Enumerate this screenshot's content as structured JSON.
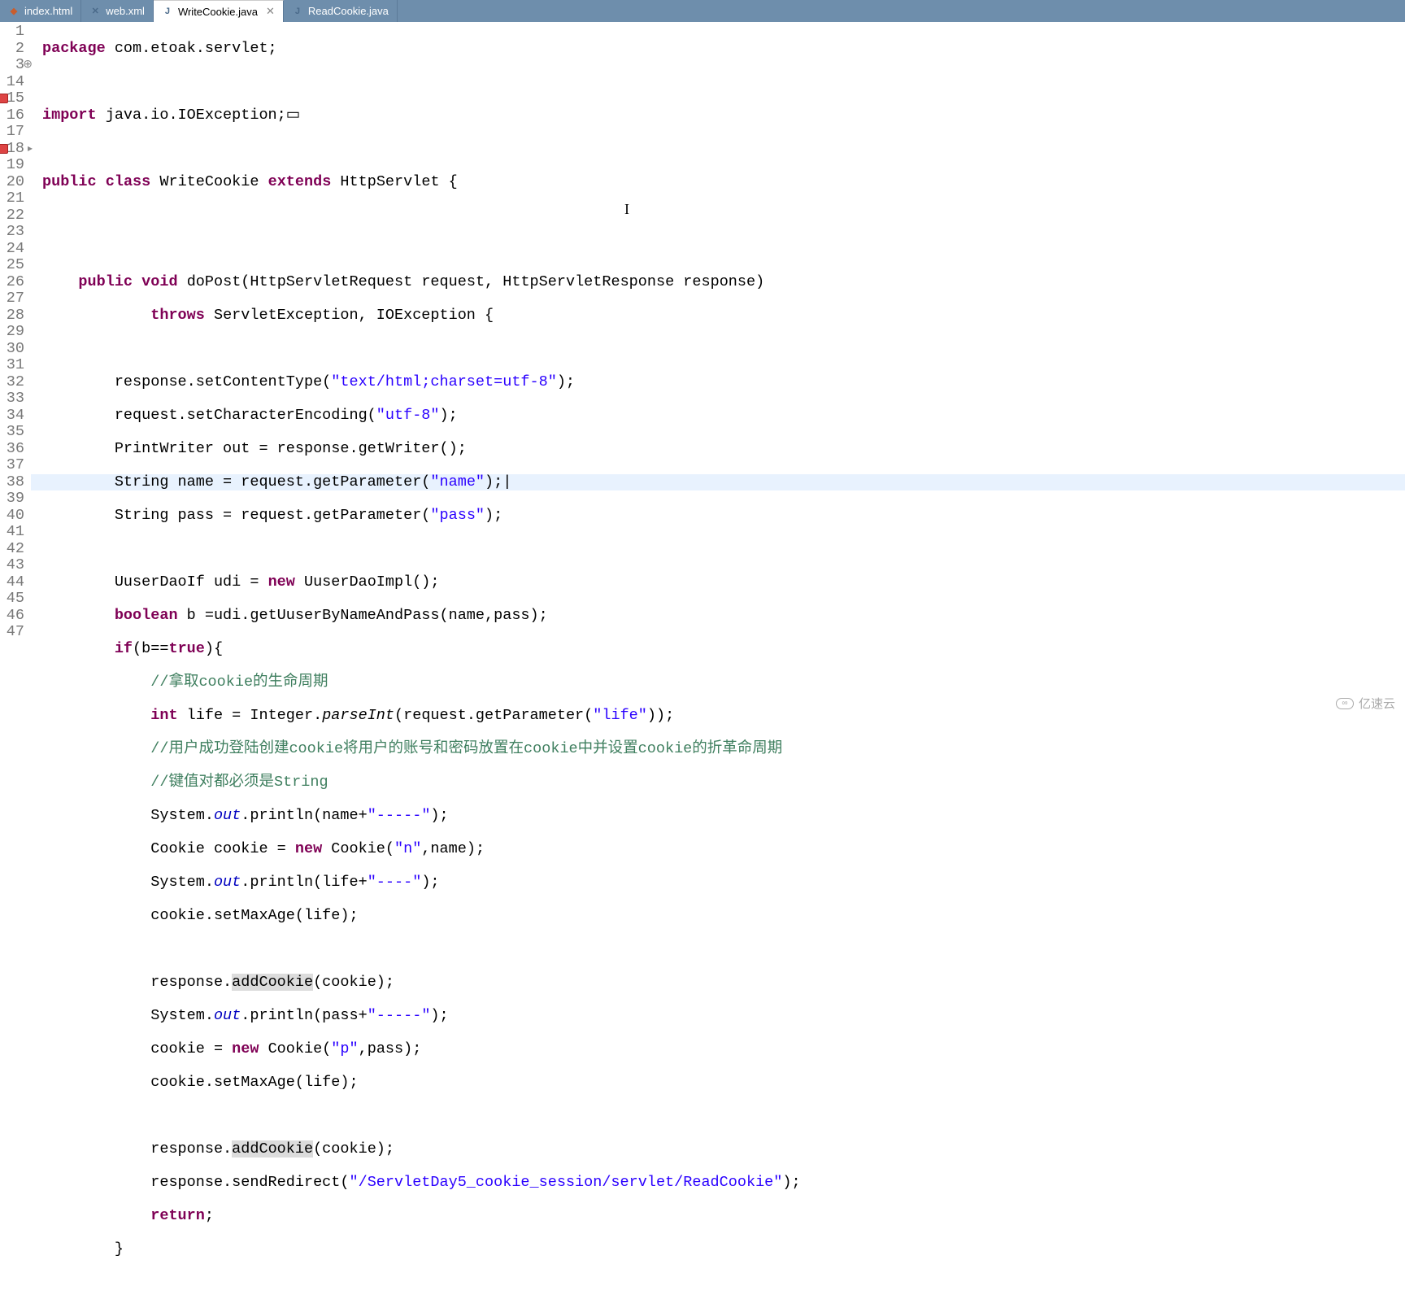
{
  "tabs": [
    {
      "label": "index.html",
      "icon": "html-icon",
      "glyph": "◆"
    },
    {
      "label": "web.xml",
      "icon": "xml-icon",
      "glyph": "✕"
    },
    {
      "label": "WriteCookie.java",
      "icon": "java-icon",
      "glyph": "J",
      "active": true,
      "closable": true
    },
    {
      "label": "ReadCookie.java",
      "icon": "java-icon",
      "glyph": "J"
    }
  ],
  "gutter": [
    "1",
    "2",
    "3",
    "14",
    "15",
    "16",
    "17",
    "18",
    "19",
    "20",
    "21",
    "22",
    "23",
    "24",
    "25",
    "26",
    "27",
    "28",
    "29",
    "30",
    "31",
    "32",
    "33",
    "34",
    "35",
    "36",
    "37",
    "38",
    "39",
    "40",
    "41",
    "42",
    "43",
    "44",
    "45",
    "46",
    "47"
  ],
  "code": {
    "l1_kw": "package",
    "l1_rest": " com.etoak.servlet;",
    "l3_kw": "import",
    "l3_rest": " java.io.IOException;",
    "l15_kw1": "public",
    "l15_kw2": "class",
    "l15_name": "WriteCookie",
    "l15_kw3": "extends",
    "l15_super": "HttpServlet {",
    "l18_kw1": "public",
    "l18_kw2": "void",
    "l18_sig": "doPost(HttpServletRequest request, HttpServletResponse response)",
    "l19_kw": "throws",
    "l19_rest": " ServletException, IOException {",
    "l21a": "response.setContentType(",
    "l21s": "\"text/html;charset=utf-8\"",
    "l21b": ");",
    "l22a": "request.setCharacterEncoding(",
    "l22s": "\"utf-8\"",
    "l22b": ");",
    "l23": "PrintWriter out = response.getWriter();",
    "l24a": "String name = request.getParameter(",
    "l24s": "\"name\"",
    "l24b": ");",
    "l25a": "String pass = request.getParameter(",
    "l25s": "\"pass\"",
    "l25b": ");",
    "l27a": "UuserDaoIf udi = ",
    "l27kw": "new",
    "l27b": " UuserDaoImpl();",
    "l28kw": "boolean",
    "l28a": " b =udi.getUuserByNameAndPass(name,pass);",
    "l29kw1": "if",
    "l29a": "(b==",
    "l29kw2": "true",
    "l29b": "){",
    "l30c": "//拿取cookie的生命周期",
    "l31kw": "int",
    "l31a": " life = Integer.",
    "l31m": "parseInt",
    "l31b": "(request.getParameter(",
    "l31s": "\"life\"",
    "l31c": "));",
    "l32c": "//用户成功登陆创建cookie将用户的账号和密码放置在cookie中并设置cookie的折革命周期",
    "l33c": "//键值对都必须是String",
    "l34a": "System.",
    "l34f": "out",
    "l34b": ".println(name+",
    "l34s": "\"-----\"",
    "l34c": ");",
    "l35a": "Cookie cookie = ",
    "l35kw": "new",
    "l35b": " Cookie(",
    "l35s": "\"n\"",
    "l35c": ",name);",
    "l36a": "System.",
    "l36f": "out",
    "l36b": ".println(life+",
    "l36s": "\"----\"",
    "l36c": ");",
    "l37": "cookie.setMaxAge(life);",
    "l39a": "response.",
    "l39m": "addCookie",
    "l39b": "(cookie);",
    "l40a": "System.",
    "l40f": "out",
    "l40b": ".println(pass+",
    "l40s": "\"-----\"",
    "l40c": ");",
    "l41a": "cookie = ",
    "l41kw": "new",
    "l41b": " Cookie(",
    "l41s": "\"p\"",
    "l41c": ",pass);",
    "l42": "cookie.setMaxAge(life);",
    "l44a": "response.",
    "l44m": "addCookie",
    "l44b": "(cookie);",
    "l45a": "response.sendRedirect(",
    "l45s": "\"/ServletDay5_cookie_session/servlet/ReadCookie\"",
    "l45b": ");",
    "l46kw": "return",
    "l46b": ";",
    "l47": "}"
  },
  "watermark": "亿速云"
}
